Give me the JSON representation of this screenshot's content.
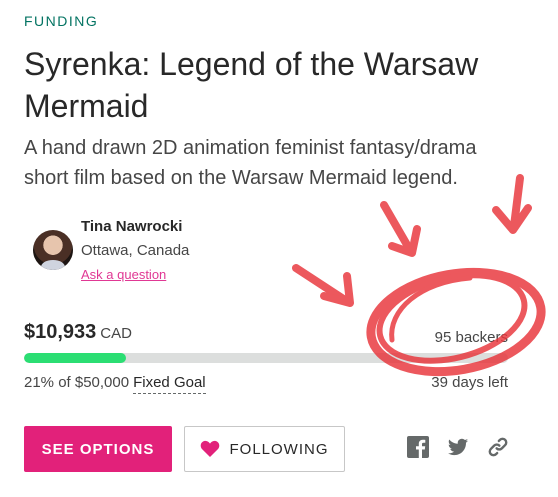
{
  "project": {
    "category": "FUNDING",
    "title": "Syrenka: Legend of the Warsaw Mermaid",
    "blurb": "A hand drawn 2D animation feminist fantasy/drama short film based on the Warsaw Mermaid legend."
  },
  "creator": {
    "name": "Tina Nawrocki",
    "location": "Ottawa, Canada",
    "ask_link": "Ask a question"
  },
  "funding": {
    "pledged": "$10,933",
    "currency": "CAD",
    "backers": "95 backers",
    "goal_text": "21% of $50,000",
    "goal_type": "Fixed Goal",
    "days_left": "39 days left",
    "progress_fraction": 0.21
  },
  "actions": {
    "see_options": "SEE OPTIONS",
    "following": "FOLLOWING"
  },
  "social": [
    "facebook-icon",
    "twitter-icon",
    "link-icon"
  ],
  "colors": {
    "accent": "#e2217a",
    "progress": "#2bde73",
    "eyebrow": "#037362",
    "annotation": "#e8343a"
  }
}
